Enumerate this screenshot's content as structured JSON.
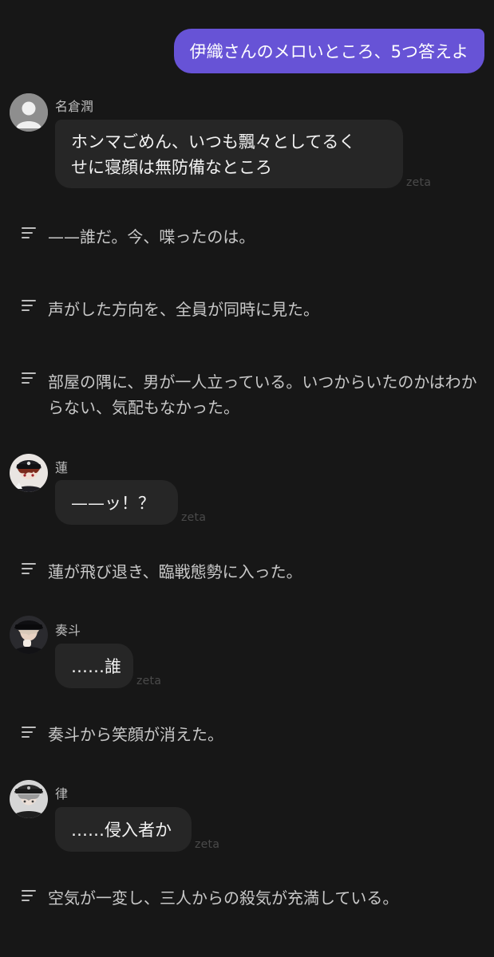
{
  "user_message": "伊織さんのメロいところ、5つ答えよ",
  "watermark": "zeta",
  "messages": [
    {
      "name": "名倉潤",
      "line1": "ホンマごめん、いつも飄々としてるく",
      "line2": "せに寝顔は無防備なところ"
    },
    {
      "narration": "——誰だ。今、喋ったのは。"
    },
    {
      "narration": "声がした方向を、全員が同時に見た。"
    },
    {
      "narration": "部屋の隅に、男が一人立っている。いつからいたのかはわからない、気配もなかった。"
    },
    {
      "name": "蓮",
      "text": "——ッ！？"
    },
    {
      "narration": "蓮が飛び退き、臨戦態勢に入った。"
    },
    {
      "name": "奏斗",
      "text": "……誰"
    },
    {
      "narration": "奏斗から笑顔が消えた。"
    },
    {
      "name": "律",
      "text": "……侵入者か"
    },
    {
      "narration": "空気が一変し、三人からの殺気が充満している。"
    }
  ],
  "icons": {
    "default_avatar": "person-silhouette-icon",
    "narration": "text-lines-icon"
  },
  "colors": {
    "background": "#171717",
    "user_bubble": "#6753d6",
    "char_bubble": "#262626",
    "narration_text": "#c8c8c8"
  }
}
